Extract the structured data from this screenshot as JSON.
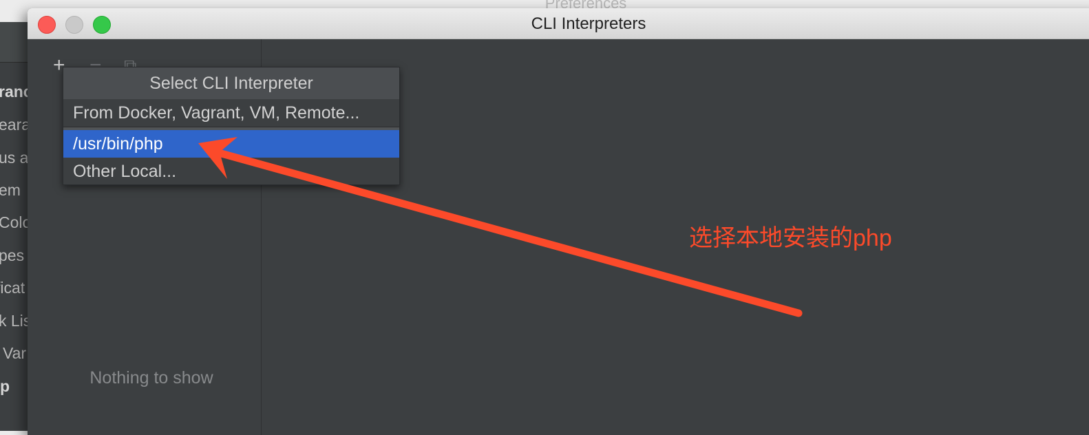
{
  "background_window": {
    "title": "Preferences",
    "sidebar_items": [
      {
        "label": "ranc",
        "bold": true
      },
      {
        "label": "eara",
        "bold": false
      },
      {
        "label": "us a",
        "bold": false
      },
      {
        "label": "em",
        "bold": false
      },
      {
        "label": "Colo",
        "bold": false
      },
      {
        "label": "pes",
        "bold": false
      },
      {
        "label": "ficat",
        "bold": false
      },
      {
        "label": "k Lis",
        "bold": false
      },
      {
        "label": "Var",
        "bold": false
      },
      {
        "label": "p",
        "bold": true
      }
    ]
  },
  "dialog": {
    "title": "CLI Interpreters",
    "toolbar": {
      "add_icon": "+",
      "remove_icon": "−",
      "copy_icon": "⧉"
    },
    "empty_text": "Nothing to show"
  },
  "popup": {
    "header": "Select CLI Interpreter",
    "items": [
      {
        "label": "From Docker, Vagrant, VM, Remote..."
      },
      {
        "label": "/usr/bin/php",
        "selected": true
      },
      {
        "label": "Other Local..."
      }
    ]
  },
  "annotation": {
    "text": "选择本地安装的php",
    "color": "#fc4a2a"
  },
  "colors": {
    "selection": "#2f65ca",
    "dark_bg": "#3c3f41"
  }
}
